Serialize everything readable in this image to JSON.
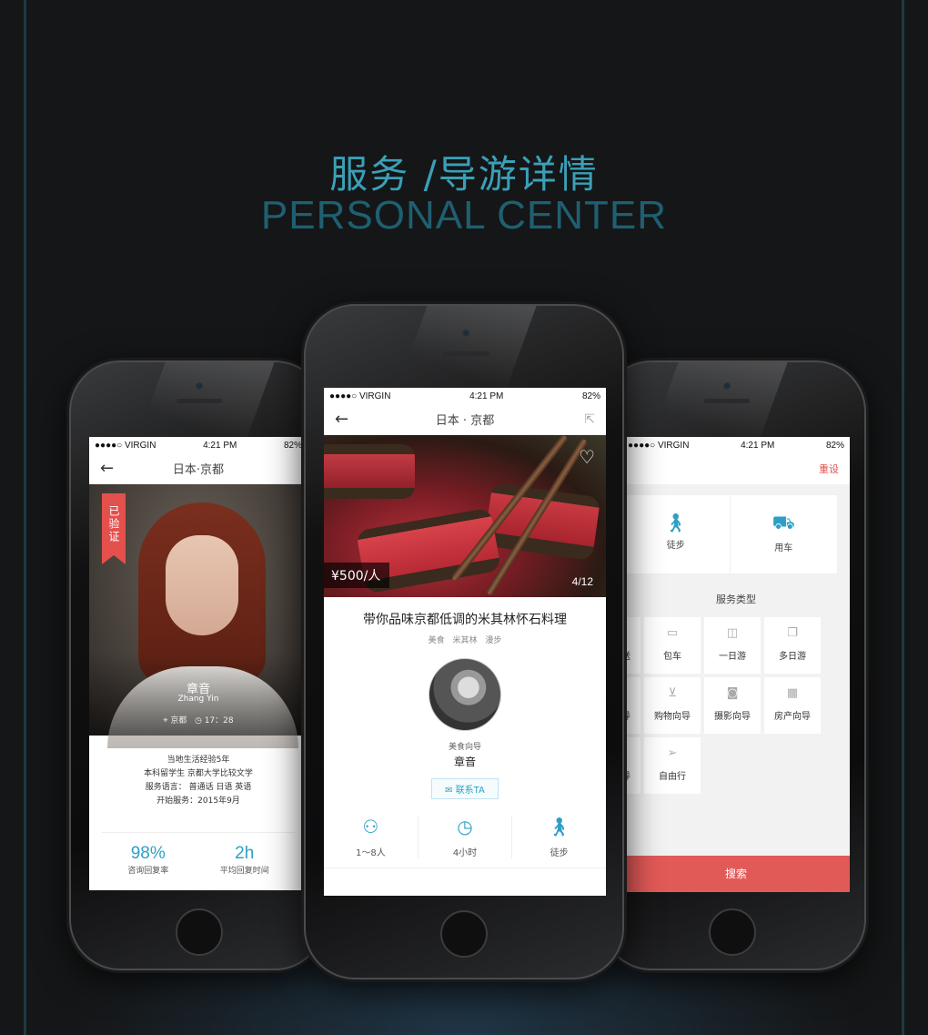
{
  "heading": {
    "title_cn": "服务 /导游详情",
    "title_en": "PERSONAL CENTER"
  },
  "status_bar": {
    "carrier": "●●●●○ VIRGIN",
    "time": "4:21 PM",
    "battery": "82%"
  },
  "left_screen": {
    "nav_title": "日本·京都",
    "verified_label": "已验证",
    "guide_name": "章音",
    "guide_pinyin": "Zhang Yin",
    "location": "京都",
    "local_time": "17：28",
    "bio": [
      "当地生活经验5年",
      "本科留学生  京都大学比较文学",
      "服务语言： 普通话 日语 英语",
      "开始服务：2015年9月"
    ],
    "stats": [
      {
        "value": "98%",
        "label": "咨询回复率"
      },
      {
        "value": "2h",
        "label": "平均回复时间"
      }
    ]
  },
  "mid_screen": {
    "nav_title": "日本 · 京都",
    "price": "¥500/人",
    "counter": "4/12",
    "title": "带你品味京都低调的米其林怀石料理",
    "tags": [
      "美食",
      "米其林",
      "漫步"
    ],
    "role": "美食向导",
    "name": "章音",
    "contact_label": "联系TA",
    "facts": [
      {
        "icon": "people-icon",
        "label": "1～8人"
      },
      {
        "icon": "clock-icon",
        "label": "4小时"
      },
      {
        "icon": "walk-icon",
        "label": "徒步"
      }
    ]
  },
  "right_screen": {
    "reset_label": "重设",
    "modes": [
      {
        "icon": "walk-icon",
        "label": "徒步"
      },
      {
        "icon": "car-icon",
        "label": "用车"
      }
    ],
    "section_title": "服务类型",
    "service_types": [
      {
        "icon": "plane-icon",
        "label": "机场接送"
      },
      {
        "icon": "bus-icon",
        "label": "包车"
      },
      {
        "icon": "bag-icon",
        "label": "一日游"
      },
      {
        "icon": "doc-icon",
        "label": "多日游"
      },
      {
        "icon": "dish-icon",
        "label": "美食向导"
      },
      {
        "icon": "cart-icon",
        "label": "购物向导"
      },
      {
        "icon": "camera-icon",
        "label": "摄影向导"
      },
      {
        "icon": "building-icon",
        "label": "房产向导"
      },
      {
        "icon": "eye-icon",
        "label": "探访向导"
      },
      {
        "icon": "plane-paper-icon",
        "label": "自由行"
      }
    ],
    "search_label": "搜索"
  },
  "colors": {
    "accent": "#2e9fc4",
    "heading": "#3aa0b8",
    "alert": "#e4504c"
  }
}
